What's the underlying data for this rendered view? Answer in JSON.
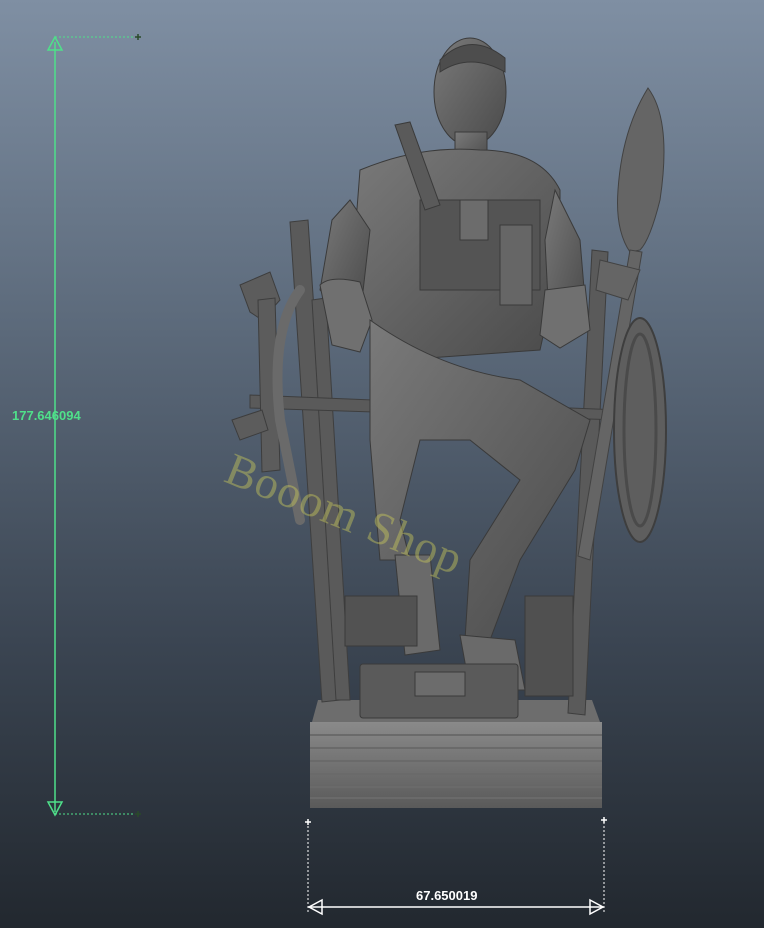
{
  "viewport": {
    "background_top": "#7f8fa3",
    "background_bottom": "#22282f",
    "model_color": "#5e5e5e",
    "height_guide_color": "#4fe08a",
    "width_guide_color": "#ffffff"
  },
  "measurements": {
    "height_value": "177.646094",
    "width_value": "67.650019"
  },
  "watermark": {
    "text": "Booom Shop"
  },
  "model": {
    "subject": "seated-soldier-figure"
  }
}
